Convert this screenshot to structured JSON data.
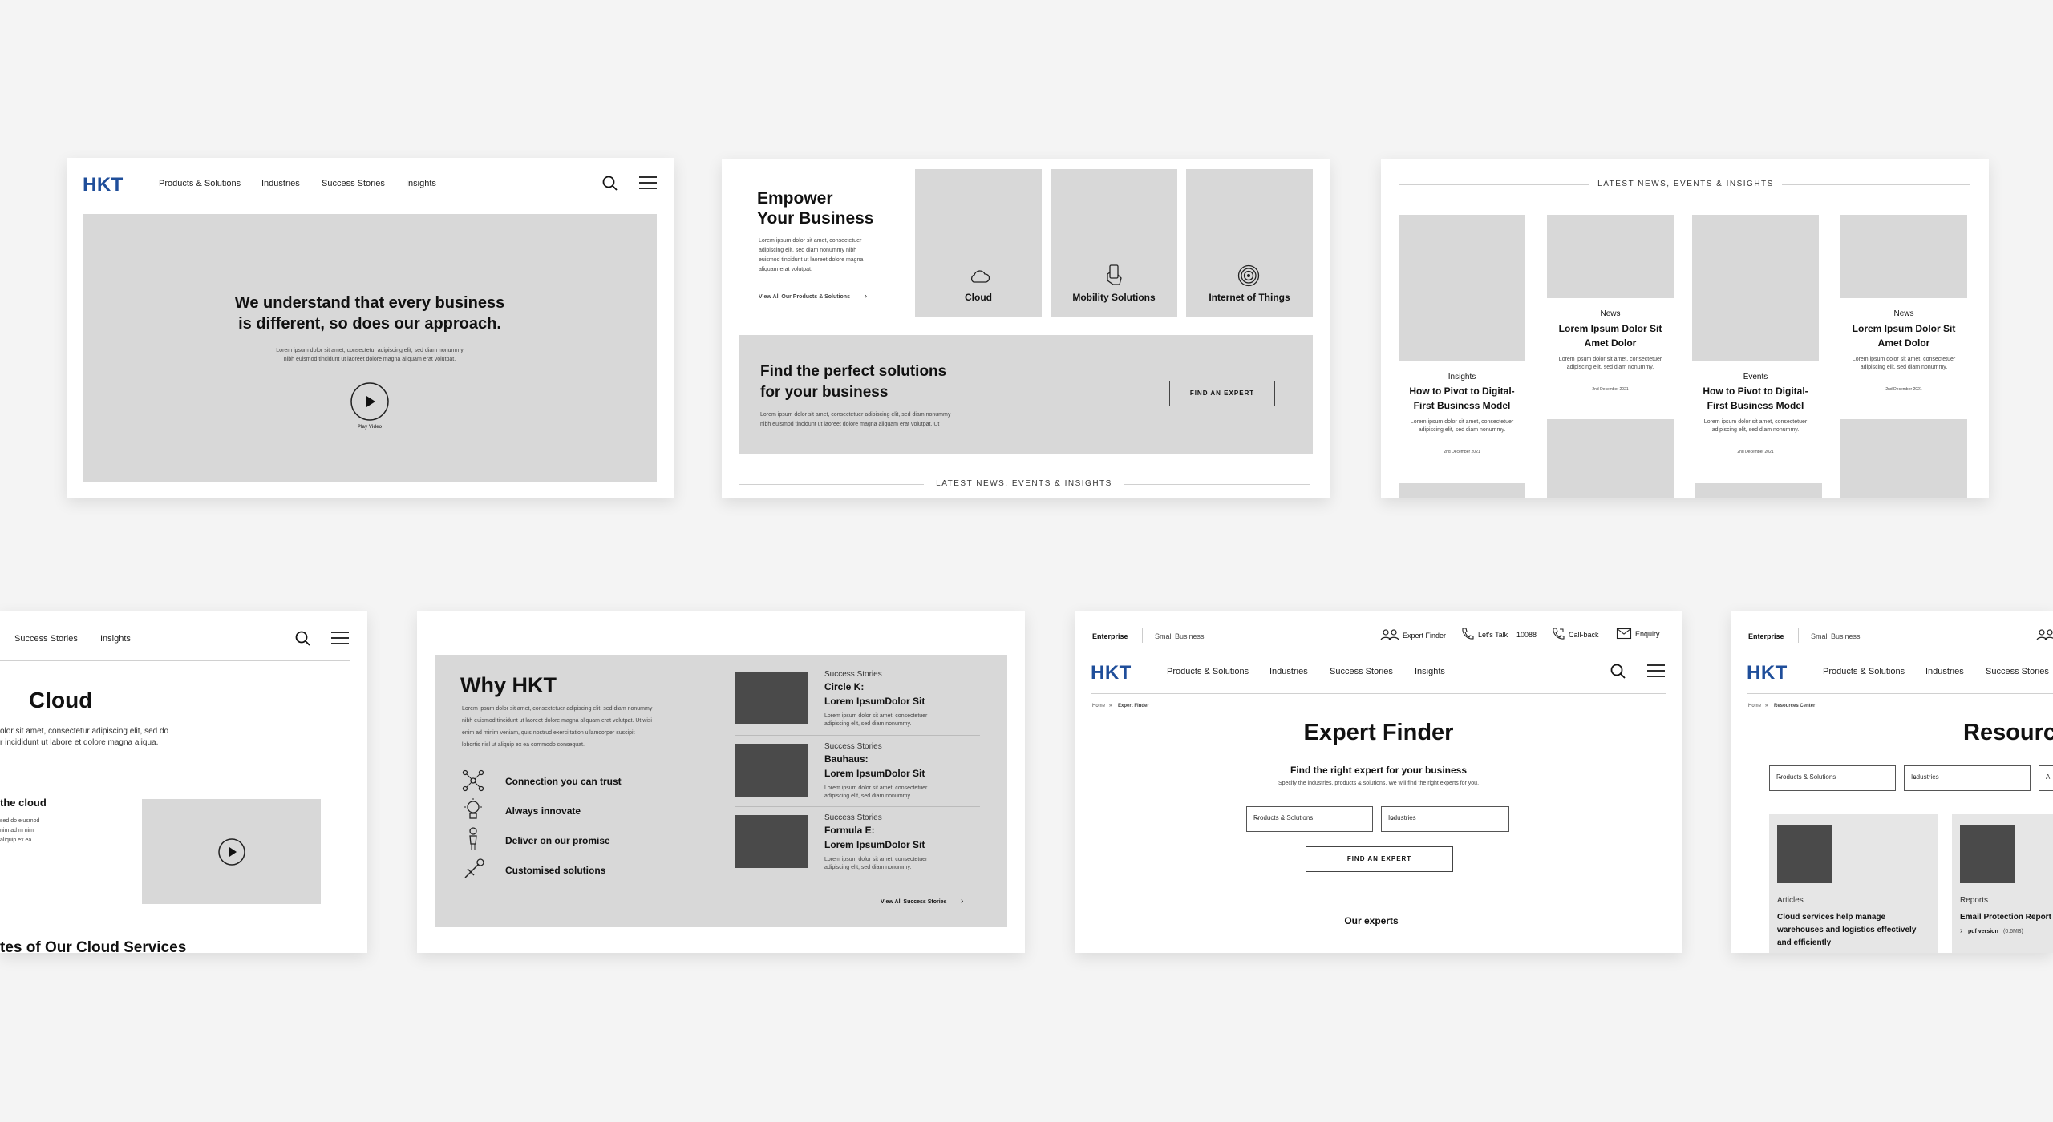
{
  "common": {
    "logo": "HKT",
    "nav": [
      "Products & Solutions",
      "Industries",
      "Success Stories",
      "Insights"
    ],
    "topbar": {
      "enterprise": "Enterprise",
      "small_business": "Small Business"
    }
  },
  "card1": {
    "hero_title_1": "We understand that every business",
    "hero_title_2": "is different, so does our approach.",
    "hero_body_1": "Lorem ipsum dolor sit amet, consectetur adipiscing elit, sed diam nonummy",
    "hero_body_2": "nibh euismod tincidunt ut laoreet dolore magna aliquam erat volutpat.",
    "play_label": "Play Video"
  },
  "card2": {
    "empower_1": "Empower",
    "empower_2": "Your Business",
    "empower_body": [
      "Lorem ipsum dolor sit amet, consectetuer",
      "adipiscing elit, sed diam nonummy nibh",
      "euismod tincidunt ut laoreet dolore magna",
      "aliquam erat volutpat."
    ],
    "view_all": "View All Our Products & Solutions",
    "tiles": [
      "Cloud",
      "Mobility Solutions",
      "Internet of Things"
    ],
    "find_1": "Find the perfect solutions",
    "find_2": "for your business",
    "find_body_1": "Lorem ipsum dolor sit amet, consectetuer adipiscing elit, sed diam nonummy",
    "find_body_2": "nibh euismod tincidunt ut laoreet dolore magna aliquam erat volutpat. Ut",
    "find_button": "FIND AN EXPERT",
    "latest": "LATEST NEWS, EVENTS & INSIGHTS"
  },
  "card3": {
    "latest": "LATEST NEWS, EVENTS & INSIGHTS",
    "items": [
      {
        "cat": "Insights",
        "title_1": "How to Pivot to Digital-",
        "title_2": "First Business Model",
        "body_1": "Lorem ipsum dolor sit amet, consectetuer",
        "body_2": "adipiscing elit, sed diam nonummy.",
        "date": "2nd December 2021"
      },
      {
        "cat": "News",
        "title_1": "Lorem Ipsum Dolor Sit",
        "title_2": "Amet Dolor",
        "body_1": "Lorem ipsum dolor sit amet, consectetuer",
        "body_2": "adipiscing elit, sed diam nonummy.",
        "date": "2nd December 2021"
      },
      {
        "cat": "Events",
        "title_1": "How to Pivot to Digital-",
        "title_2": "First Business Model",
        "body_1": "Lorem ipsum dolor sit amet, consectetuer",
        "body_2": "adipiscing elit, sed diam nonummy.",
        "date": "2nd December 2021"
      },
      {
        "cat": "News",
        "title_1": "Lorem Ipsum Dolor Sit",
        "title_2": "Amet Dolor",
        "body_1": "Lorem ipsum dolor sit amet, consectetuer",
        "body_2": "adipiscing elit, sed diam nonummy.",
        "date": "2nd December 2021"
      }
    ]
  },
  "card4": {
    "nav": [
      "Success Stories",
      "Insights"
    ],
    "title": "Cloud",
    "body_1": "olor sit amet, consectetur adipiscing elit, sed do",
    "body_2": "r incididunt ut labore et dolore magna aliqua.",
    "sub": "the cloud",
    "sub_body": [
      "sed do eiusmod",
      "nim ad m nim",
      "aliquip ex ea"
    ],
    "section": "tes of Our Cloud Services"
  },
  "card5": {
    "title": "Why HKT",
    "body": [
      "Lorem ipsum dolor sit amet, consectetuer adipiscing elit, sed diam nonummy",
      "nibh euismod tincidunt ut laoreet dolore magna aliquam erat volutpat. Ut wisi",
      "enim ad minim veniam, quis nostrud exerci tation ullamcorper suscipit",
      "lobortis nisl ut aliquip ex ea commodo consequat."
    ],
    "features": [
      "Connection you can trust",
      "Always innovate",
      "Deliver on our promise",
      "Customised solutions"
    ],
    "stories": [
      {
        "cat": "Success Stories",
        "name": "Circle K:",
        "title": "Lorem IpsumDolor Sit",
        "body_1": "Lorem ipsum dolor sit amet, consectetuer",
        "body_2": "adipiscing elit, sed diam nonummy."
      },
      {
        "cat": "Success Stories",
        "name": "Bauhaus:",
        "title": "Lorem IpsumDolor Sit",
        "body_1": "Lorem ipsum dolor sit amet, consectetuer",
        "body_2": "adipiscing elit, sed diam nonummy."
      },
      {
        "cat": "Success Stories",
        "name": "Formula E:",
        "title": "Lorem IpsumDolor Sit",
        "body_1": "Lorem ipsum dolor sit amet, consectetuer",
        "body_2": "adipiscing elit, sed diam nonummy."
      }
    ],
    "view_all": "View All Success Stories"
  },
  "card6": {
    "expert_finder": "Expert Finder",
    "lets_talk": "Let's Talk",
    "phone": "10088",
    "callback": "Call-back",
    "enquiry": "Enquiry",
    "breadcrumb_home": "Home",
    "breadcrumb_current": "Expert Finder",
    "title": "Expert Finder",
    "sub": "Find the right expert for your business",
    "sub_body": "Specify the industries, products & solutions. We will find the right experts for you.",
    "select_1": "Products & Solutions",
    "select_2": "Industries",
    "button": "FIND AN EXPERT",
    "our_experts": "Our experts"
  },
  "card7": {
    "breadcrumb_home": "Home",
    "breadcrumb_current": "Resources Center",
    "title": "Resources",
    "select_1": "Products & Solutions",
    "select_2": "Industries",
    "select_3": "A",
    "res_1": {
      "cat": "Articles",
      "title": [
        "Cloud services help manage",
        "warehouses and logistics effectively",
        "and efficiently"
      ]
    },
    "res_2": {
      "cat": "Reports",
      "title": "Email Protection Report",
      "pdf": "pdf version",
      "size": "(0.6MB)"
    }
  }
}
